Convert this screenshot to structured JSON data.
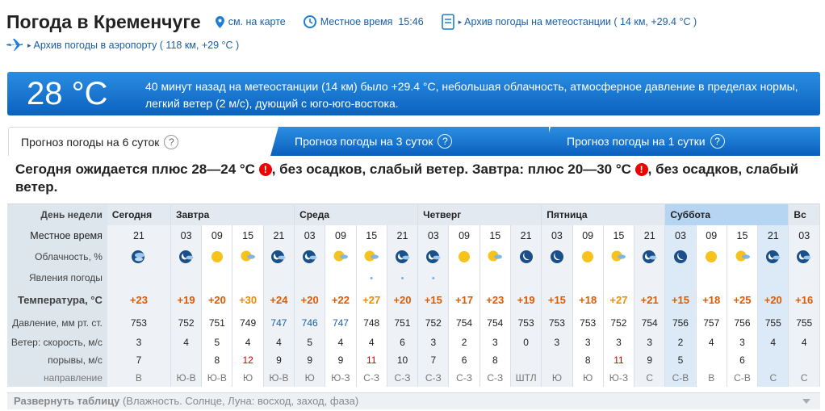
{
  "header": {
    "title": "Погода в Кременчуге",
    "map_link": "см. на карте",
    "local_time_label": "Местное время",
    "local_time": "15:46",
    "archive_station": "Архив погоды на метеостанции ( 14 км, +29.4 °C )",
    "archive_airport": "Архив погоды в аэропорту ( 118 км, +29 °C )"
  },
  "current": {
    "temp": "28 °C",
    "description": "40 минут назад на метеостанции (14 км) было +29.4 °C, небольшая облачность, атмосферное давление в пределах нормы, легкий ветер (2 м/с), дующий с юго-юго-востока."
  },
  "tabs": [
    {
      "label": "Прогноз погоды на 6 суток",
      "q": "?"
    },
    {
      "label": "Прогноз погоды на 3 суток",
      "q": "?"
    },
    {
      "label": "Прогноз погоды на 1 сутки",
      "q": "?"
    }
  ],
  "summary": {
    "part1": "Сегодня ожидается плюс 28—24 °C",
    "part2": ", без осадков, слабый ветер. Завтра: плюс 20—30 °C",
    "part3": ", без осадков, слабый ветер.",
    "warn": "!"
  },
  "table": {
    "labels": {
      "day": "День недели",
      "time": "Местное время",
      "clouds": "Облачность, %",
      "phen": "Явления погоды",
      "temp": "Температура, °C",
      "press": "Давление, мм рт. ст.",
      "wind": "Ветер: скорость, м/с",
      "gust": "порывы, м/с",
      "dir": "направление"
    },
    "days": [
      "Сегодня",
      "Завтра",
      "Среда",
      "Четверг",
      "Пятница",
      "Суббота",
      "Вс"
    ],
    "times": [
      "21",
      "03",
      "09",
      "15",
      "21",
      "03",
      "09",
      "15",
      "21",
      "03",
      "09",
      "15",
      "21",
      "03",
      "09",
      "15",
      "21",
      "03",
      "09",
      "15",
      "21",
      "03"
    ],
    "temps": [
      "+23",
      "+19",
      "+20",
      "+30",
      "+24",
      "+20",
      "+22",
      "+27",
      "+20",
      "+15",
      "+17",
      "+23",
      "+19",
      "+15",
      "+18",
      "+27",
      "+21",
      "+15",
      "+18",
      "+25",
      "+20",
      "+16"
    ],
    "temp_colors": [
      "#e05a00",
      "#e05a00",
      "#e05a00",
      "#f08c00",
      "#e05a00",
      "#e05a00",
      "#e05a00",
      "#f08c00",
      "#e05a00",
      "#e05a00",
      "#e05a00",
      "#e05a00",
      "#e05a00",
      "#e05a00",
      "#e05a00",
      "#f08c00",
      "#e05a00",
      "#e05a00",
      "#e05a00",
      "#e05a00",
      "#e05a00",
      "#e05a00"
    ],
    "pressure": [
      "753",
      "752",
      "751",
      "749",
      "747",
      "746",
      "747",
      "748",
      "751",
      "752",
      "754",
      "754",
      "753",
      "753",
      "753",
      "752",
      "754",
      "756",
      "757",
      "756",
      "755",
      "755"
    ],
    "pressure_colors": [
      "#222",
      "#222",
      "#222",
      "#222",
      "#1c5ea3",
      "#1c5ea3",
      "#1c5ea3",
      "#222",
      "#222",
      "#222",
      "#222",
      "#222",
      "#222",
      "#222",
      "#222",
      "#222",
      "#222",
      "#222",
      "#222",
      "#222",
      "#222",
      "#222"
    ],
    "wind": [
      "3",
      "4",
      "5",
      "4",
      "4",
      "5",
      "4",
      "4",
      "6",
      "3",
      "2",
      "3",
      "0",
      "3",
      "3",
      "3",
      "3",
      "2",
      "4",
      "3",
      "4",
      "4"
    ],
    "gust": [
      "7",
      "",
      "8",
      "12",
      "9",
      "9",
      "9",
      "11",
      "10",
      "7",
      "6",
      "8",
      "",
      "",
      "8",
      "11",
      "9",
      "5",
      "",
      "6",
      "",
      ""
    ],
    "gust_colors": [
      "#222",
      "#222",
      "#222",
      "#c00",
      "#222",
      "#222",
      "#222",
      "#c00",
      "#222",
      "#222",
      "#222",
      "#222",
      "#222",
      "#222",
      "#222",
      "#c00",
      "#222",
      "#222",
      "#222",
      "#222",
      "#222",
      "#222"
    ],
    "dir": [
      "В",
      "Ю-В",
      "Ю-В",
      "Ю",
      "Ю-В",
      "Ю",
      "Ю-З",
      "С-З",
      "С-З",
      "С-З",
      "С-З",
      "С-З",
      "ШТЛ",
      "Ю",
      "Ю",
      "Ю-З",
      "С",
      "С-В",
      "В",
      "С-В",
      "С",
      "С"
    ],
    "icons": [
      "night-clouds-icon",
      "night-partly-icon",
      "sun-icon",
      "sun-cloud-icon",
      "night-partly-icon",
      "night-partly-icon",
      "sun-cloud-icon",
      "sun-cloud-icon",
      "night-partly-icon",
      "night-partly-icon",
      "sun-icon",
      "sun-cloud-icon",
      "night-clear-icon",
      "night-clear-icon",
      "sun-icon",
      "sun-cloud-icon",
      "night-partly-icon",
      "night-clear-icon",
      "sun-icon",
      "sun-cloud-icon",
      "night-partly-icon",
      "night-partly-icon"
    ],
    "phen": [
      "",
      "",
      "",
      "",
      "",
      "",
      "",
      "•",
      "•",
      "•",
      "",
      "",
      "",
      "",
      "",
      "",
      "",
      "",
      "",
      "",
      "",
      ""
    ]
  },
  "footer": {
    "bold": "Развернуть таблицу",
    "rest": " (Влажность. Солнце, Луна: восход, заход, фаза)"
  }
}
